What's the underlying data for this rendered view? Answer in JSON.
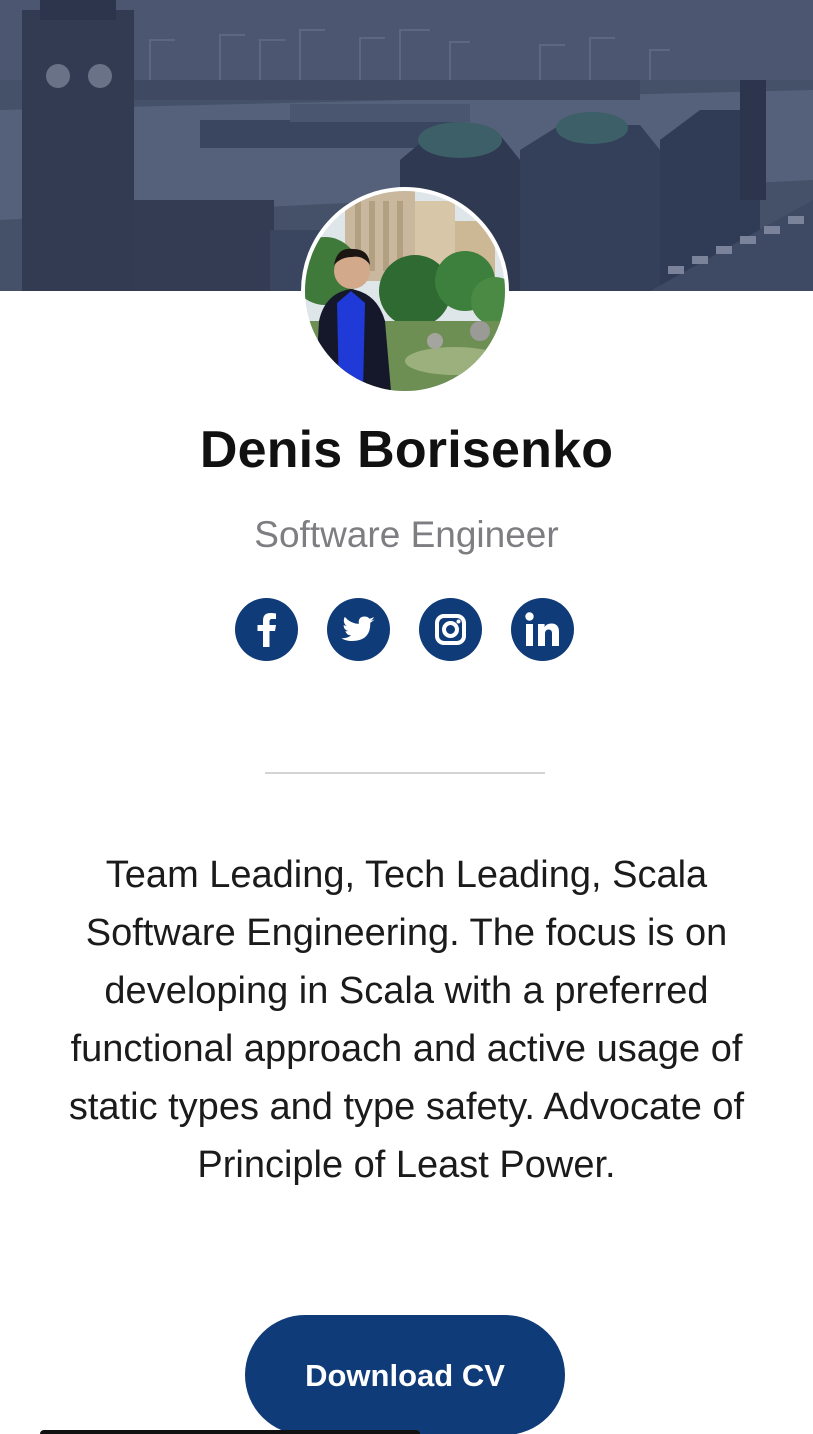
{
  "profile": {
    "name": "Denis Borisenko",
    "role": "Software Engineer",
    "bio": "Team Leading, Tech Leading, Scala Software Engineering. The focus is on developing in Scala with a preferred functional approach and active usage of static types and type safety. Advocate of Principle of Least Power."
  },
  "socials": [
    {
      "icon": "facebook-icon"
    },
    {
      "icon": "twitter-icon"
    },
    {
      "icon": "instagram-icon"
    },
    {
      "icon": "linkedin-icon"
    }
  ],
  "actions": {
    "download_cv_label": "Download CV"
  },
  "colors": {
    "brand": "#0f3b78",
    "name_text": "#111111",
    "role_text": "#7d7d82",
    "divider": "#d4d4d4",
    "banner_tint": "#3c4967"
  }
}
